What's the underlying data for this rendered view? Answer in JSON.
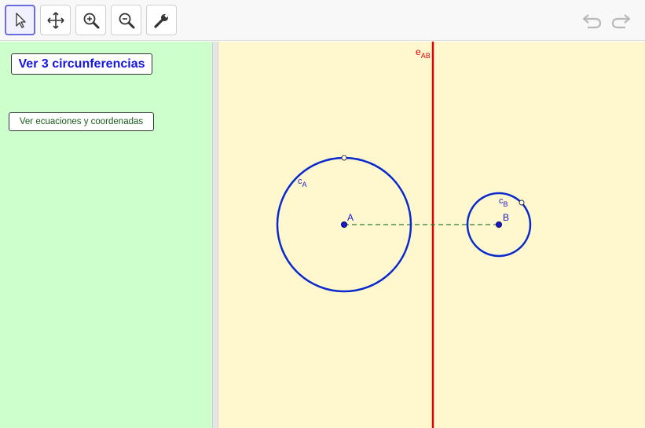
{
  "toolbar": {
    "tools": [
      {
        "name": "move-tool",
        "icon": "arrow-cursor-icon"
      },
      {
        "name": "move-graphics-view-tool",
        "icon": "four-way-arrows-icon"
      },
      {
        "name": "zoom-in-tool",
        "icon": "zoom-in-icon"
      },
      {
        "name": "zoom-out-tool",
        "icon": "zoom-out-icon"
      },
      {
        "name": "properties-tool",
        "icon": "wrench-icon"
      }
    ],
    "undo_icon": "undo-icon",
    "redo_icon": "redo-icon"
  },
  "left_panel": {
    "button_three_circles": "Ver 3 circunferencias",
    "button_equations": "Ver ecuaciones y coordenadas"
  },
  "graphics": {
    "point_A_label": "A",
    "point_B_label": "B",
    "circle_A_label_main": "c",
    "circle_A_label_sub": "A",
    "circle_B_label_main": "c",
    "circle_B_label_sub": "B",
    "line_label_main": "e",
    "line_label_sub": "AB",
    "colors": {
      "circle": "#0a2acc",
      "line": "#e00000",
      "segment": "#2e7d2e",
      "canvas_bg": "#fff8cf",
      "panel_bg": "#ccffcc"
    }
  }
}
